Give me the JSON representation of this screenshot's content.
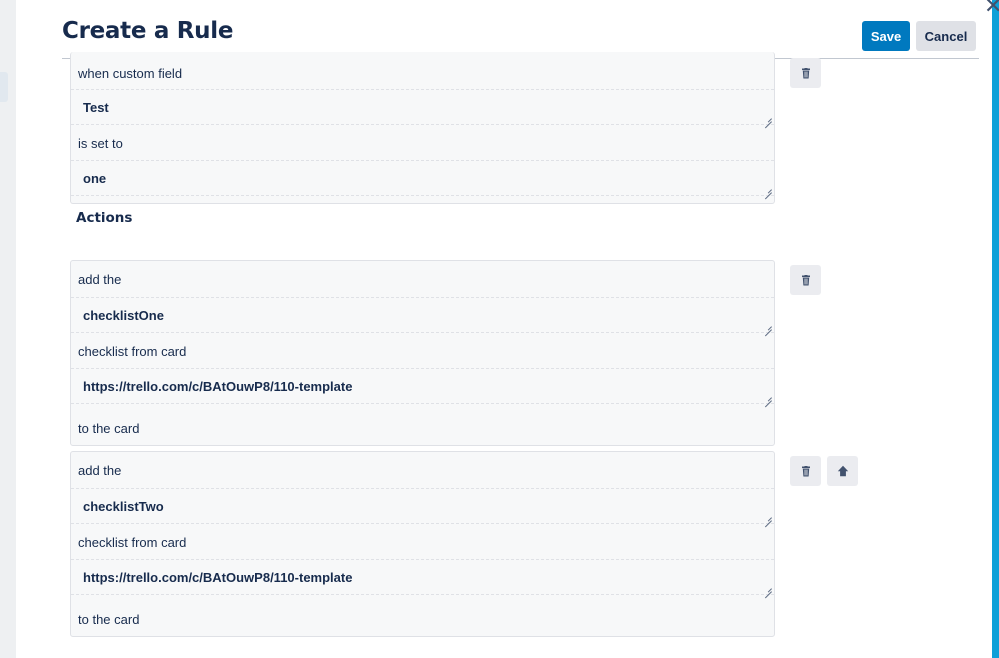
{
  "dialog": {
    "title": "Create a Rule",
    "save_label": "Save",
    "cancel_label": "Cancel",
    "close_glyph": "✕"
  },
  "trigger": {
    "prefix": "when custom field",
    "field_value": "Test",
    "middle": "is set to",
    "set_value": "one"
  },
  "actions": {
    "section_title": "Actions",
    "items": [
      {
        "prefix": "add the",
        "checklist_value": "checklistOne",
        "middle": "checklist from card",
        "card_value": "https://trello.com/c/BAtOuwP8/110-template",
        "suffix": "to the card"
      },
      {
        "prefix": "add the",
        "checklist_value": "checklistTwo",
        "middle": "checklist from card",
        "card_value": "https://trello.com/c/BAtOuwP8/110-template",
        "suffix": "to the card"
      }
    ]
  },
  "icons": {
    "close": "close-icon",
    "delete": "trash-icon",
    "move_up": "arrow-up-icon"
  },
  "colors": {
    "primary": "#0079bf",
    "accent_edge": "#0ea0d8",
    "text": "#172b4d"
  }
}
